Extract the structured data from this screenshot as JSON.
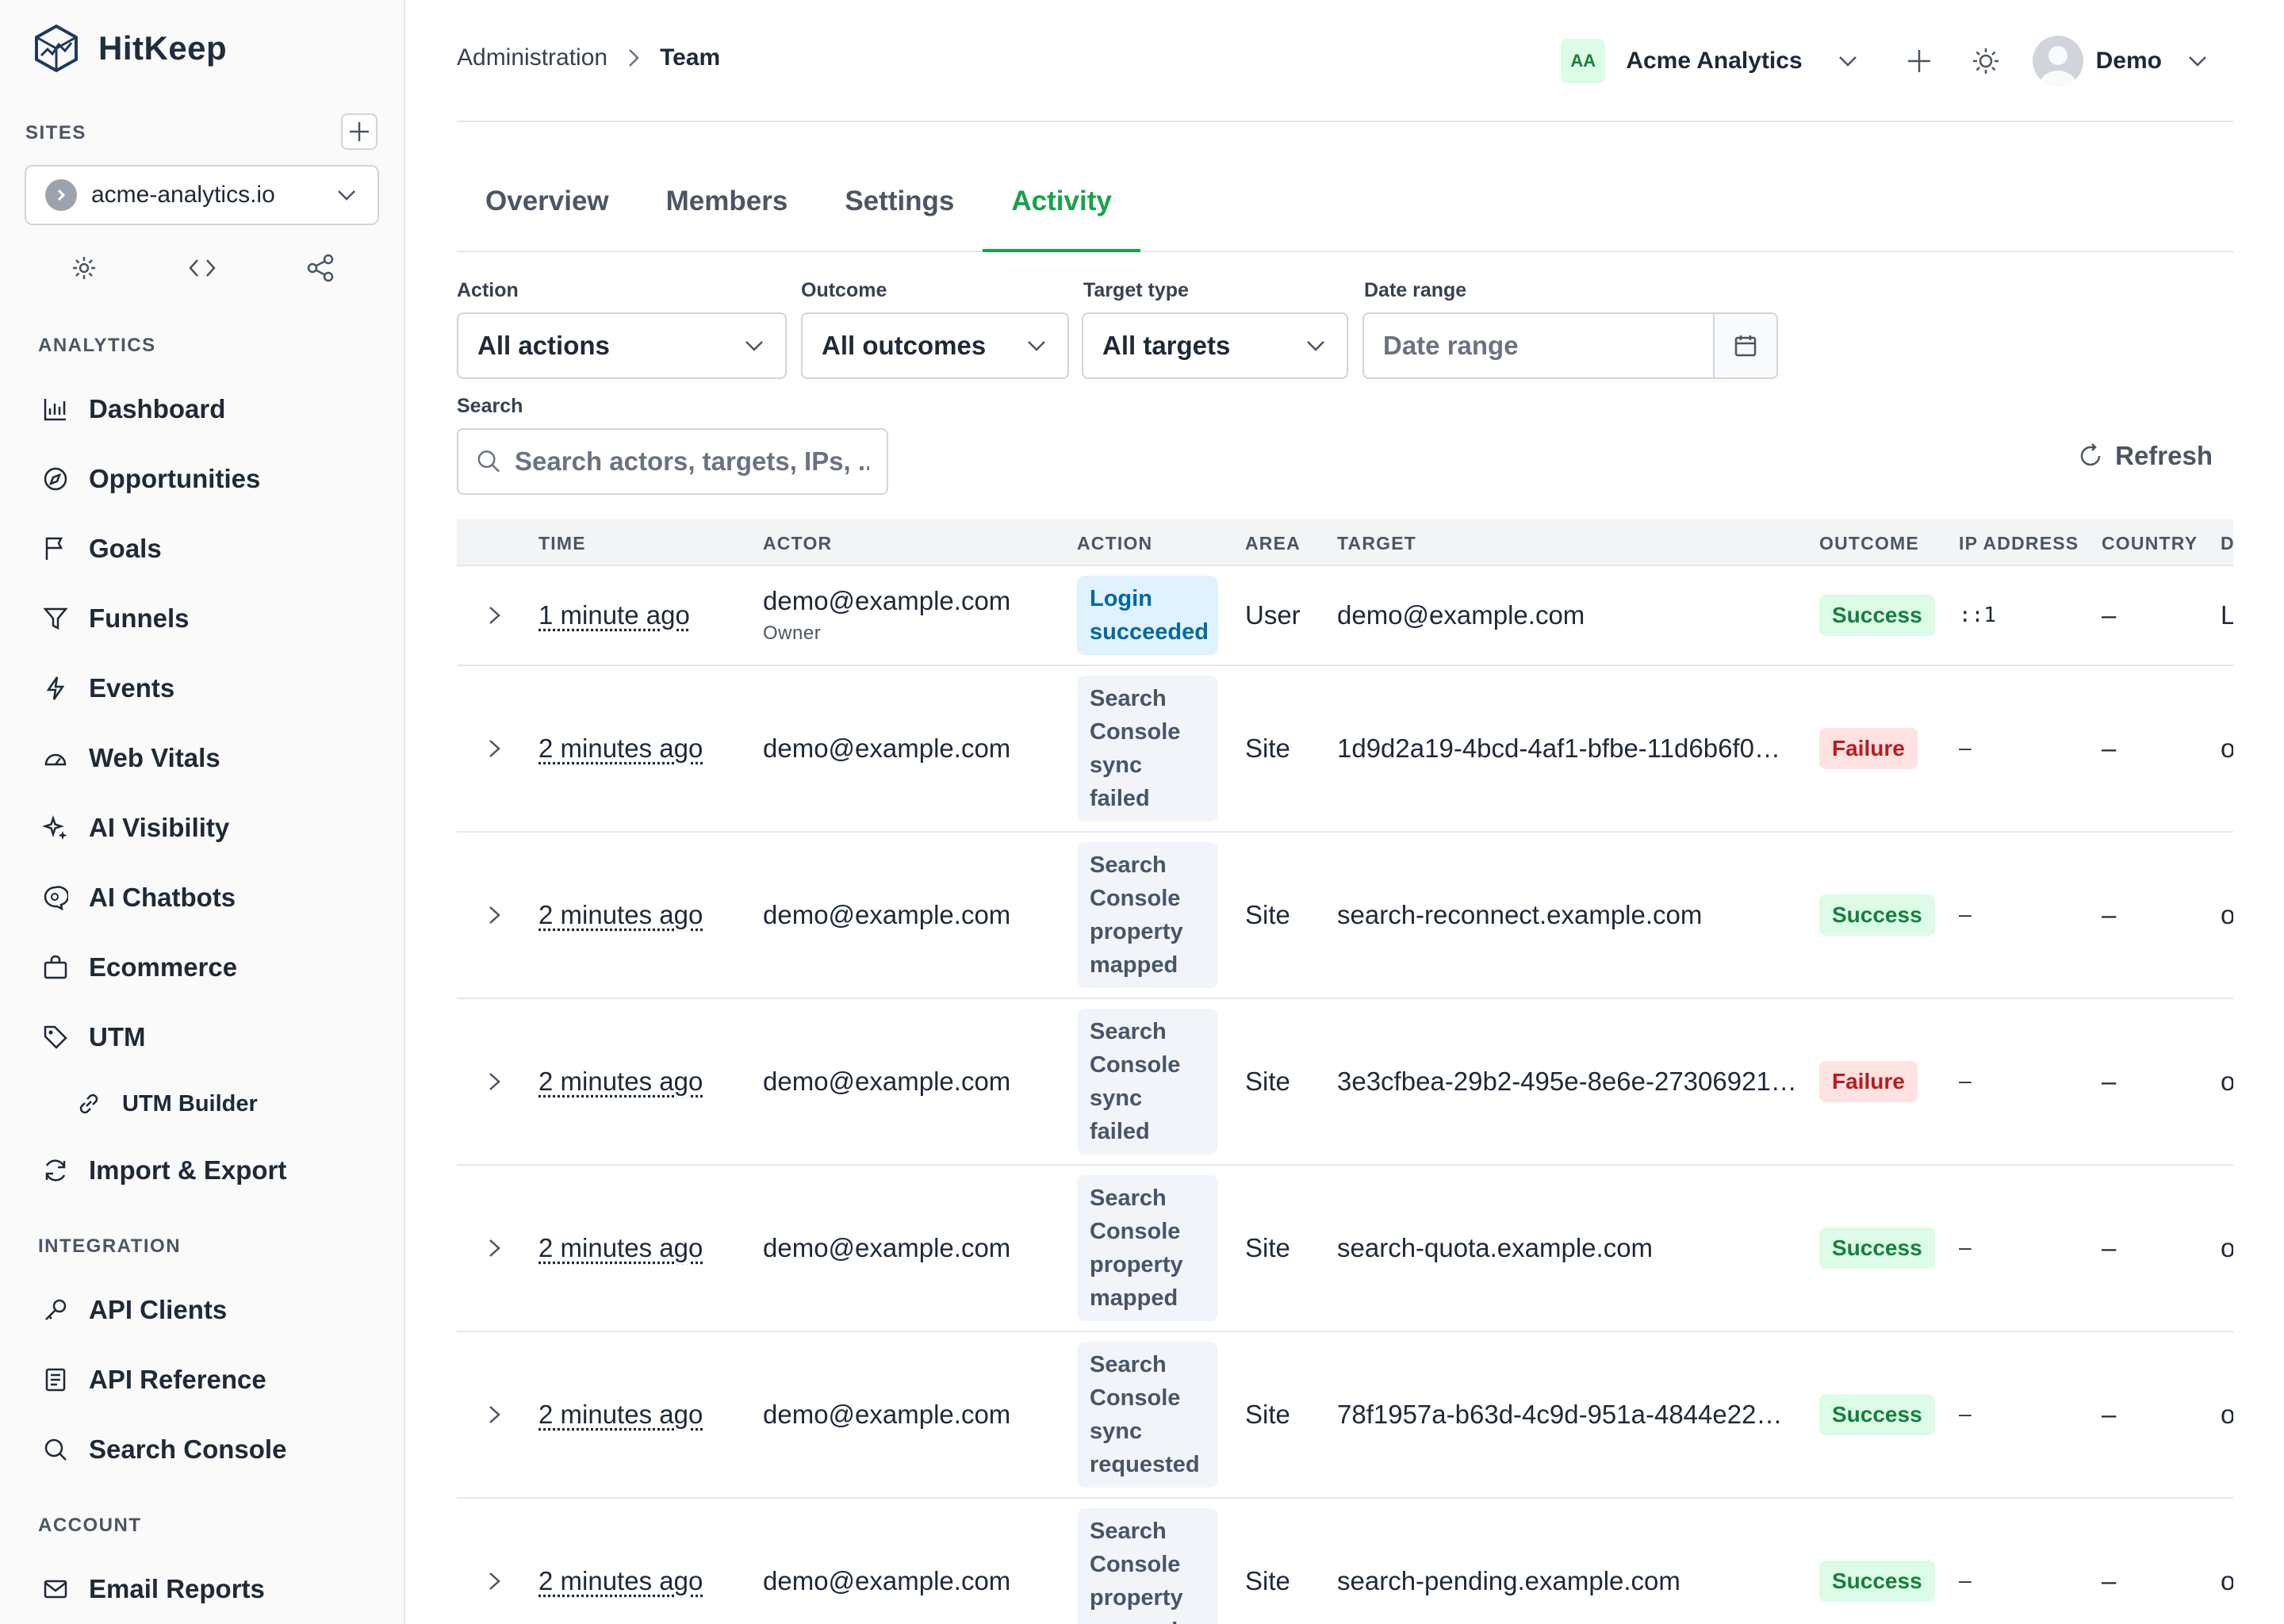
{
  "app": {
    "name": "HitKeep"
  },
  "sidebar": {
    "sites_label": "SITES",
    "selected_site": "acme-analytics.io",
    "sections": [
      {
        "label": "ANALYTICS"
      },
      {
        "label": "INTEGRATION"
      },
      {
        "label": "ACCOUNT"
      }
    ],
    "items": [
      {
        "label": "Dashboard",
        "icon": "bar-chart-icon"
      },
      {
        "label": "Opportunities",
        "icon": "compass-icon"
      },
      {
        "label": "Goals",
        "icon": "flag-icon"
      },
      {
        "label": "Funnels",
        "icon": "filter-icon"
      },
      {
        "label": "Events",
        "icon": "bolt-icon"
      },
      {
        "label": "Web Vitals",
        "icon": "gauge-icon"
      },
      {
        "label": "AI Visibility",
        "icon": "sparkles-icon"
      },
      {
        "label": "AI Chatbots",
        "icon": "chat-search-icon"
      },
      {
        "label": "Ecommerce",
        "icon": "shopping-bag-icon"
      },
      {
        "label": "UTM",
        "icon": "tag-icon"
      },
      {
        "label": "UTM Builder",
        "icon": "link-icon"
      },
      {
        "label": "Import & Export",
        "icon": "sync-icon"
      },
      {
        "label": "API Clients",
        "icon": "key-icon"
      },
      {
        "label": "API Reference",
        "icon": "document-icon"
      },
      {
        "label": "Search Console",
        "icon": "search-icon"
      },
      {
        "label": "Email Reports",
        "icon": "mail-icon"
      }
    ]
  },
  "header": {
    "breadcrumb": [
      "Administration",
      "Team"
    ],
    "org_initials": "AA",
    "org_name": "Acme Analytics",
    "user_name": "Demo"
  },
  "tabs": [
    "Overview",
    "Members",
    "Settings",
    "Activity"
  ],
  "active_tab": "Activity",
  "filters": {
    "action_label": "Action",
    "action_value": "All actions",
    "outcome_label": "Outcome",
    "outcome_value": "All outcomes",
    "target_label": "Target type",
    "target_value": "All targets",
    "date_label": "Date range",
    "date_placeholder": "Date range",
    "search_label": "Search",
    "search_placeholder": "Search actors, targets, IPs, ...",
    "refresh_label": "Refresh"
  },
  "table": {
    "columns": [
      "TIME",
      "ACTOR",
      "ACTION",
      "AREA",
      "TARGET",
      "OUTCOME",
      "IP ADDRESS",
      "COUNTRY",
      "D"
    ],
    "rows": [
      {
        "time": "1 minute ago",
        "actor": "demo@example.com",
        "role": "Owner",
        "action": "Login succeeded",
        "area": "User",
        "target": "demo@example.com",
        "outcome": "Success",
        "ip": "::1",
        "country": "–",
        "device": "L"
      },
      {
        "time": "2 minutes ago",
        "actor": "demo@example.com",
        "role": "",
        "action": "Search Console sync failed",
        "area": "Site",
        "target": "1d9d2a19-4bcd-4af1-bfbe-11d6b6f0…",
        "outcome": "Failure",
        "ip": "–",
        "country": "–",
        "device": "o"
      },
      {
        "time": "2 minutes ago",
        "actor": "demo@example.com",
        "role": "",
        "action": "Search Console property mapped",
        "area": "Site",
        "target": "search-reconnect.example.com",
        "outcome": "Success",
        "ip": "–",
        "country": "–",
        "device": "o"
      },
      {
        "time": "2 minutes ago",
        "actor": "demo@example.com",
        "role": "",
        "action": "Search Console sync failed",
        "area": "Site",
        "target": "3e3cfbea-29b2-495e-8e6e-27306921…",
        "outcome": "Failure",
        "ip": "–",
        "country": "–",
        "device": "o"
      },
      {
        "time": "2 minutes ago",
        "actor": "demo@example.com",
        "role": "",
        "action": "Search Console property mapped",
        "area": "Site",
        "target": "search-quota.example.com",
        "outcome": "Success",
        "ip": "–",
        "country": "–",
        "device": "o"
      },
      {
        "time": "2 minutes ago",
        "actor": "demo@example.com",
        "role": "",
        "action": "Search Console sync requested",
        "area": "Site",
        "target": "78f1957a-b63d-4c9d-951a-4844e22…",
        "outcome": "Success",
        "ip": "–",
        "country": "–",
        "device": "o"
      },
      {
        "time": "2 minutes ago",
        "actor": "demo@example.com",
        "role": "",
        "action": "Search Console property mapped",
        "area": "Site",
        "target": "search-pending.example.com",
        "outcome": "Success",
        "ip": "–",
        "country": "–",
        "device": "o"
      }
    ]
  },
  "colors": {
    "accent": "#16a34a",
    "success": "#15803d",
    "failure": "#b91c1c",
    "login_chip": "#0369a1"
  }
}
